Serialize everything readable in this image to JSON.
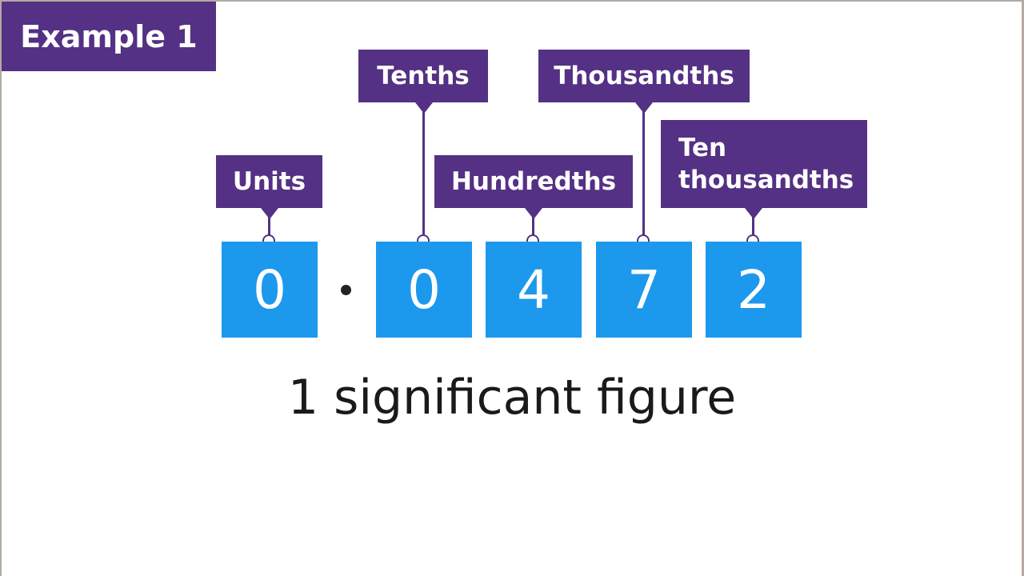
{
  "title": "Example 1",
  "number": {
    "digits": [
      "0",
      "0",
      "4",
      "7",
      "2"
    ],
    "decimal_point": "·",
    "value": "0.0472"
  },
  "labels": {
    "units": "Units",
    "tenths": "Tenths",
    "hundredths": "Hundredths",
    "thousandths": "Thousandths",
    "ten_thousandths_line1": "Ten",
    "ten_thousandths_line2": "thousandths"
  },
  "caption": "1 significant figure",
  "colors": {
    "label_purple": "#543184",
    "digit_blue": "#1c99ed",
    "text_dark": "#1a1a1a"
  }
}
